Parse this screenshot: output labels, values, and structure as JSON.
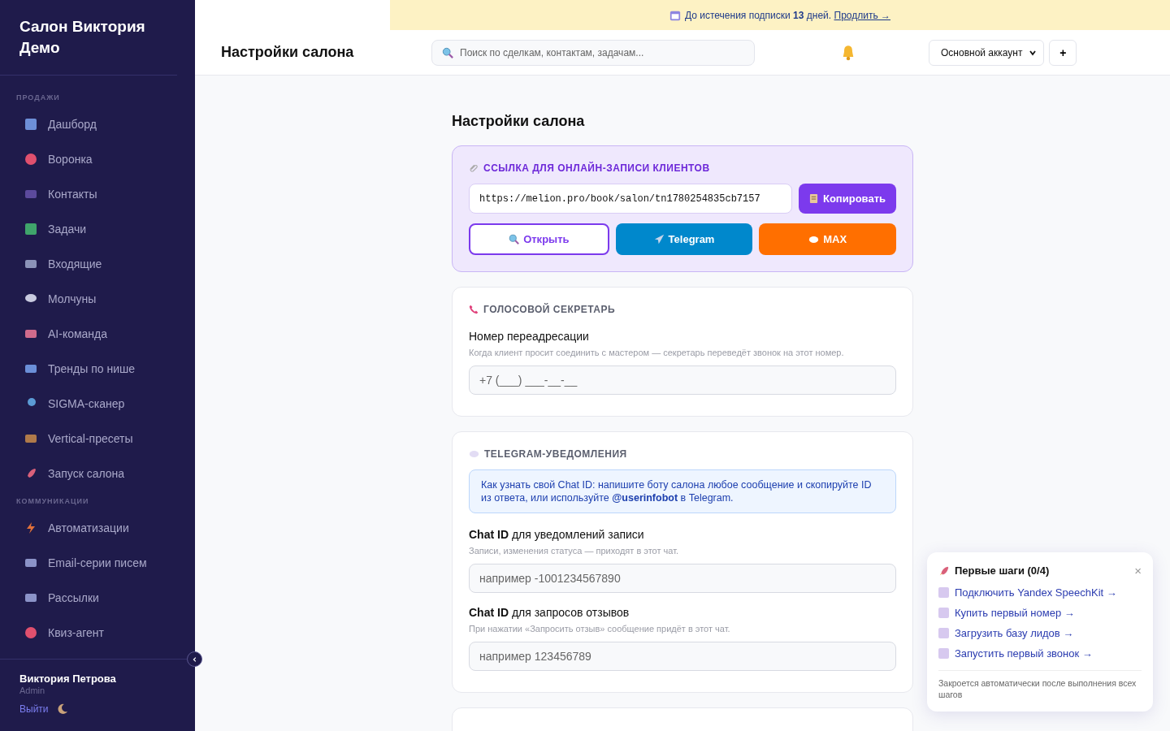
{
  "sidebar": {
    "brand": "Салон Виктория Демо",
    "sections": [
      {
        "title": "ПРОДАЖИ",
        "items": [
          {
            "label": "Дашборд",
            "selected": false
          },
          {
            "label": "Воронка",
            "selected": false
          },
          {
            "label": "Контакты",
            "selected": false
          },
          {
            "label": "Задачи",
            "selected": false
          },
          {
            "label": "Входящие",
            "selected": false
          },
          {
            "label": "Молчуны",
            "selected": false
          },
          {
            "label": "AI-команда",
            "selected": false
          },
          {
            "label": "Тренды по нише",
            "selected": false
          },
          {
            "label": "SIGMA-сканер",
            "selected": false
          },
          {
            "label": "Vertical-пресеты",
            "selected": false
          },
          {
            "label": "Запуск салона",
            "selected": false
          }
        ]
      },
      {
        "title": "КОММУНИКАЦИИ",
        "items": [
          {
            "label": "Автоматизации",
            "selected": false
          },
          {
            "label": "Email-серии писем",
            "selected": false
          },
          {
            "label": "Рассылки",
            "selected": false
          },
          {
            "label": "Квиз-агент",
            "selected": false
          }
        ]
      }
    ],
    "user": {
      "name": "Виктория Петрова",
      "role": "Admin",
      "logout": "Выйти"
    }
  },
  "banner": {
    "text": "До истечения подписки **13** дней.",
    "link": "Продлить →"
  },
  "header": {
    "title": "Настройки салона",
    "search": {
      "placeholder": "Поиск по сделкам, контактам, задачам..."
    },
    "account": "Основной аккаунт",
    "add": "+"
  },
  "page": {
    "title": "Настройки салона",
    "booking": {
      "title": "ССЫЛКА ДЛЯ ОНЛАЙН-ЗАПИСИ КЛИЕНТОВ",
      "url": "https://melion.pro/book/salon/tn1780254835cb7157",
      "copy": "Копировать",
      "open": "Открыть",
      "telegram": "Telegram",
      "max": "MAX"
    },
    "voice": {
      "title": "ГОЛОСОВОЙ СЕКРЕТАРЬ",
      "label": "Номер переадресации",
      "hint": "Когда клиент просит соединить с мастером — секретарь переведёт звонок на этот номер.",
      "placeholder": "+7 (___) ___-__-__"
    },
    "telegram": {
      "title": "TELEGRAM-УВЕДОМЛЕНИЯ",
      "info": "Как узнать свой Chat ID: напишите боту салона любое сообщение и скопируйте ID из ответа, или используйте **@userinfobot** в Telegram.",
      "fields": [
        {
          "label": "**Chat ID** для уведомлений записи",
          "hint": "Записи, изменения статуса — приходят в этот чат.",
          "placeholder": "например -1001234567890"
        },
        {
          "label": "**Chat ID** для запросов отзывов",
          "hint": "При нажатии «Запросить отзыв» сообщение придёт в этот чат.",
          "placeholder": "например 123456789"
        }
      ]
    }
  },
  "onboarding": {
    "title": "Первые шаги (0/4)",
    "close": "×",
    "steps": [
      {
        "label": "Подключить Yandex SpeechKit →",
        "checked": false
      },
      {
        "label": "Купить первый номер →",
        "checked": false
      },
      {
        "label": "Загрузить базу лидов →",
        "checked": false
      },
      {
        "label": "Запустить первый звонок →",
        "checked": false
      }
    ],
    "note": "Закроется автоматически после выполнения всех шагов"
  }
}
